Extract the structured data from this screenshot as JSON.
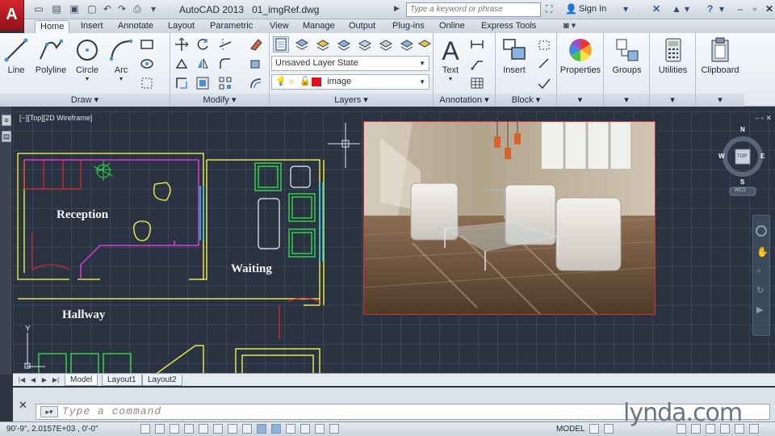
{
  "title_bar": {
    "app_name": "AutoCAD 2013",
    "file_name": "01_imgRef.dwg",
    "search_placeholder": "Type a keyword or phrase",
    "sign_in": "Sign In"
  },
  "ribbon": {
    "tabs": [
      {
        "label": "Home",
        "active": true
      },
      {
        "label": "Insert"
      },
      {
        "label": "Annotate"
      },
      {
        "label": "Layout"
      },
      {
        "label": "Parametric"
      },
      {
        "label": "View"
      },
      {
        "label": "Manage"
      },
      {
        "label": "Output"
      },
      {
        "label": "Plug-ins"
      },
      {
        "label": "Online"
      },
      {
        "label": "Express Tools"
      }
    ],
    "panels": {
      "draw": {
        "title": "Draw",
        "line": "Line",
        "polyline": "Polyline",
        "circle": "Circle",
        "arc": "Arc"
      },
      "modify": {
        "title": "Modify"
      },
      "layers": {
        "title": "Layers",
        "layer_state": "Unsaved Layer State",
        "current_layer": "image",
        "current_layer_color": "#e0101e"
      },
      "annotation": {
        "title": "Annotation",
        "text": "Text"
      },
      "block": {
        "title": "Block",
        "insert": "Insert"
      },
      "properties": {
        "label": "Properties"
      },
      "groups": {
        "label": "Groups"
      },
      "utilities": {
        "label": "Utilities"
      },
      "clipboard": {
        "label": "Clipboard"
      }
    }
  },
  "viewport": {
    "label": "[−][Top][2D Wireframe]",
    "rooms": [
      "Reception",
      "Waiting",
      "Hallway"
    ],
    "viewcube": {
      "north": "N",
      "south": "S",
      "east": "E",
      "west": "W",
      "face": "TOP",
      "ucs": "WCS"
    },
    "ucs_y": "Y"
  },
  "layout_tabs": [
    "Model",
    "Layout1",
    "Layout2"
  ],
  "command_line": {
    "placeholder": "Type  a  command"
  },
  "status_bar": {
    "coords": "90'-9\",  2.0157E+03 , 0'-0\"",
    "space": "MODEL"
  },
  "watermark": "lynda.com",
  "colors": {
    "accent": "#d3262c",
    "canvas": "#2a3341",
    "wall_yellow": "#e6e34a",
    "wall_magenta": "#d83ad8",
    "cyan": "#36c7e6",
    "green": "#37d04a",
    "red": "#e0242a"
  }
}
